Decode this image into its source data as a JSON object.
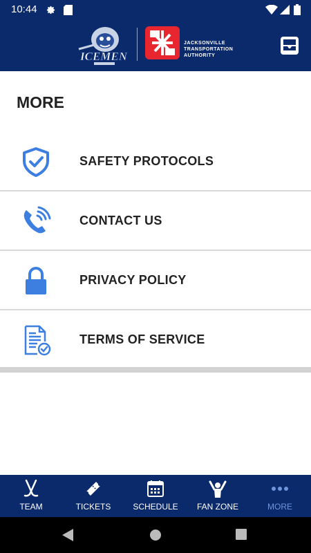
{
  "status_bar": {
    "time": "10:44"
  },
  "header": {
    "team_logo": "icemen-logo",
    "partner_logo": "jta-logo",
    "partner_name": [
      "JACKSONVILLE",
      "TRANSPORTATION",
      "AUTHORITY"
    ],
    "action_icon": "inbox-icon"
  },
  "page": {
    "title": "MORE"
  },
  "menu": {
    "items": [
      {
        "label": "SAFETY PROTOCOLS",
        "icon": "shield-check-icon"
      },
      {
        "label": "CONTACT US",
        "icon": "phone-icon"
      },
      {
        "label": "PRIVACY POLICY",
        "icon": "lock-icon"
      },
      {
        "label": "TERMS OF SERVICE",
        "icon": "document-check-icon"
      }
    ]
  },
  "tabs": [
    {
      "label": "TEAM",
      "icon": "hockey-sticks-icon"
    },
    {
      "label": "TICKETS",
      "icon": "ticket-icon"
    },
    {
      "label": "SCHEDULE",
      "icon": "calendar-icon"
    },
    {
      "label": "FAN ZONE",
      "icon": "fan-icon"
    },
    {
      "label": "MORE",
      "icon": "more-dots-icon",
      "active": true
    }
  ],
  "colors": {
    "brand_navy": "#0b2a6b",
    "accent_blue": "#3d7fe0",
    "active_tab": "#6f95dc",
    "jta_red": "#e8262f"
  }
}
